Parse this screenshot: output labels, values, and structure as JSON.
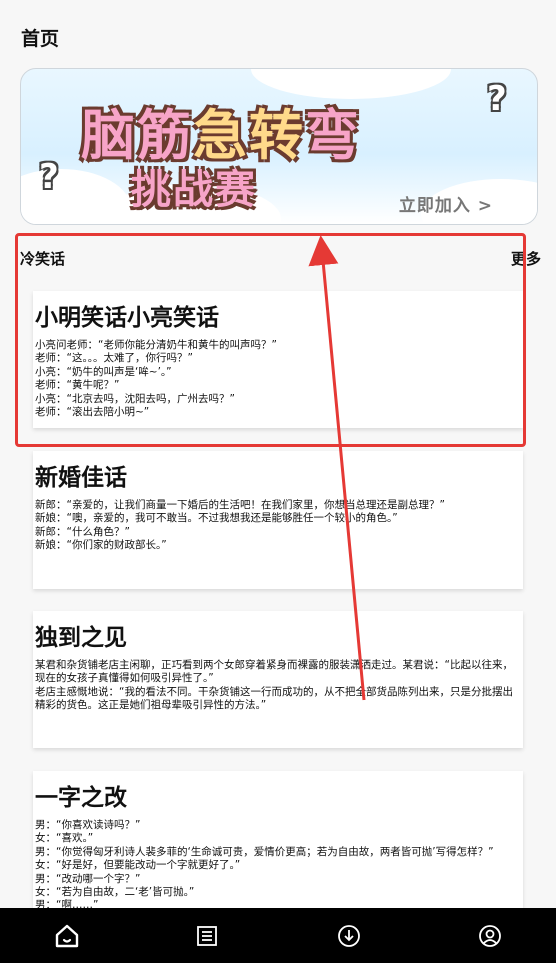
{
  "page": {
    "title": "首页"
  },
  "banner": {
    "line1_a": "脑筋",
    "line1_b": "急转",
    "line1_c": "弯",
    "line2": "挑战赛",
    "cta": "立即加入 >"
  },
  "section": {
    "label": "冷笑话",
    "more": "更多"
  },
  "cards": [
    {
      "title": "小明笑话小亮笑话",
      "body": "小亮问老师：“老师你能分清奶牛和黄牛的叫声吗？”\n老师：“这。。。太难了，你行吗？”\n小亮：“奶牛的叫声是‘哞~’。”\n老师：“黄牛呢？”\n小亮：“北京去吗，沈阳去吗，广州去吗？”\n老师：“滚出去陪小明~”"
    },
    {
      "title": "新婚佳话",
      "body": "新郎：“亲爱的，让我们商量一下婚后的生活吧！在我们家里，你想当总理还是副总理？”\n新娘：“噢，亲爱的，我可不敢当。不过我想我还是能够胜任一个较小的角色。”\n新郎：“什么角色？”\n新娘：“你们家的财政部长。”"
    },
    {
      "title": "独到之见",
      "body": "某君和杂货铺老店主闲聊，正巧看到两个女郎穿着紧身而裸露的服装潇洒走过。某君说：“比起以往来，现在的女孩子真懂得如何吸引异性了。”\n老店主感慨地说：“我的看法不同。干杂货铺这一行而成功的，从不把全部货品陈列出来，只是分批摆出精彩的货色。这正是她们祖母辈吸引异性的方法。”"
    },
    {
      "title": "一字之改",
      "body": "男：“你喜欢读诗吗？”\n女：“喜欢。”\n男：“你觉得匈牙利诗人裴多菲的‘生命诚可贵，爱情价更高；若为自由故，两者皆可抛’写得怎样？”\n女：“好是好，但要能改动一个字就更好了。”\n男：“改动哪一个字？”\n女：“若为自由故，二‘老’皆可抛。”\n男：“啊……”"
    }
  ],
  "nav": {
    "items": [
      {
        "icon": "home-icon",
        "active": true
      },
      {
        "icon": "list-icon",
        "active": false
      },
      {
        "icon": "download-icon",
        "active": false
      },
      {
        "icon": "user-icon",
        "active": false
      }
    ]
  },
  "annotation": {
    "color": "#e53935"
  }
}
